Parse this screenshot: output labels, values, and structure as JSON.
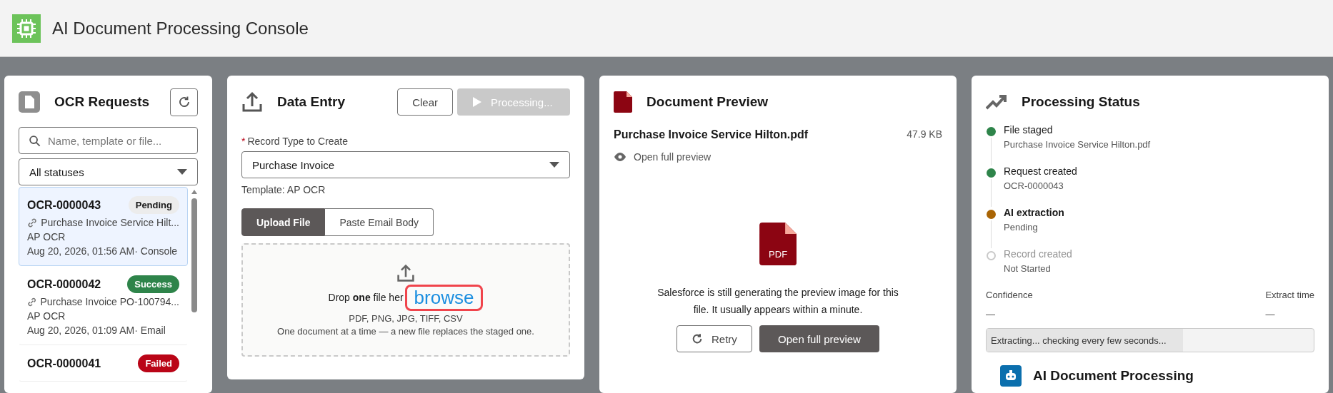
{
  "header": {
    "title": "AI Document Processing Console"
  },
  "requests": {
    "title": "OCR Requests",
    "search": {
      "placeholder": "Name, template or file..."
    },
    "status_filter": {
      "value": "All statuses"
    },
    "items": [
      {
        "id": "OCR-0000043",
        "status": "Pending",
        "color": "#ececec",
        "file": "Purchase Invoice Service Hilt...",
        "template": "AP OCR",
        "meta": "Aug 20, 2026, 01:56 AM· Console",
        "selected": true
      },
      {
        "id": "OCR-0000042",
        "status": "Success",
        "color": "#2e844a",
        "file": "Purchase Invoice PO-100794...",
        "template": "AP OCR",
        "meta": "Aug 20, 2026, 01:09 AM· Email",
        "selected": false
      },
      {
        "id": "OCR-0000041",
        "status": "Failed",
        "color": "#ba0517",
        "selected": false
      }
    ]
  },
  "data_entry": {
    "title": "Data Entry",
    "clear_button": "Clear",
    "process_button": {
      "label": "Processing...",
      "disabled": true
    },
    "record_type": {
      "label": "Record Type to Create",
      "required_mark": "*",
      "value": "Purchase Invoice"
    },
    "template": "Template: AP OCR",
    "tabs": [
      {
        "label": "Upload File",
        "selected": true
      },
      {
        "label": "Paste Email Body",
        "selected": false
      }
    ],
    "dropzone": {
      "line": "Drop **one** file her",
      "link": "browse",
      "formats": "PDF, PNG, JPG, TIFF, CSV",
      "note": "One document at a time — a new file replaces the staged one."
    }
  },
  "preview": {
    "title": "Document Preview",
    "file_name": "Purchase Invoice Service Hilton.pdf",
    "file_size": "47.9 KB",
    "open_link": "Open full preview",
    "icon_label": "PDF",
    "message": "Salesforce is still generating the preview image for this file. It usually appears within a minute.",
    "retry_button": "Retry",
    "open_button": "Open full preview"
  },
  "status": {
    "title": "Processing Status",
    "steps": [
      {
        "label": "File staged",
        "detail": "Purchase Invoice Service Hilton.pdf",
        "kind": "done"
      },
      {
        "label": "Request created",
        "detail": "OCR-0000043",
        "kind": "done"
      },
      {
        "label": "AI extraction",
        "detail": "Pending",
        "kind": "active"
      },
      {
        "label": "Record created",
        "detail": "Not Started",
        "kind": "pending"
      }
    ],
    "confidence": {
      "label": "Confidence",
      "value": "—"
    },
    "extract_time": {
      "label": "Extract time",
      "value": "—"
    },
    "progress": {
      "text": "Extracting... checking every few seconds...",
      "level": 0.6
    },
    "section_title": "AI Document Processing"
  }
}
